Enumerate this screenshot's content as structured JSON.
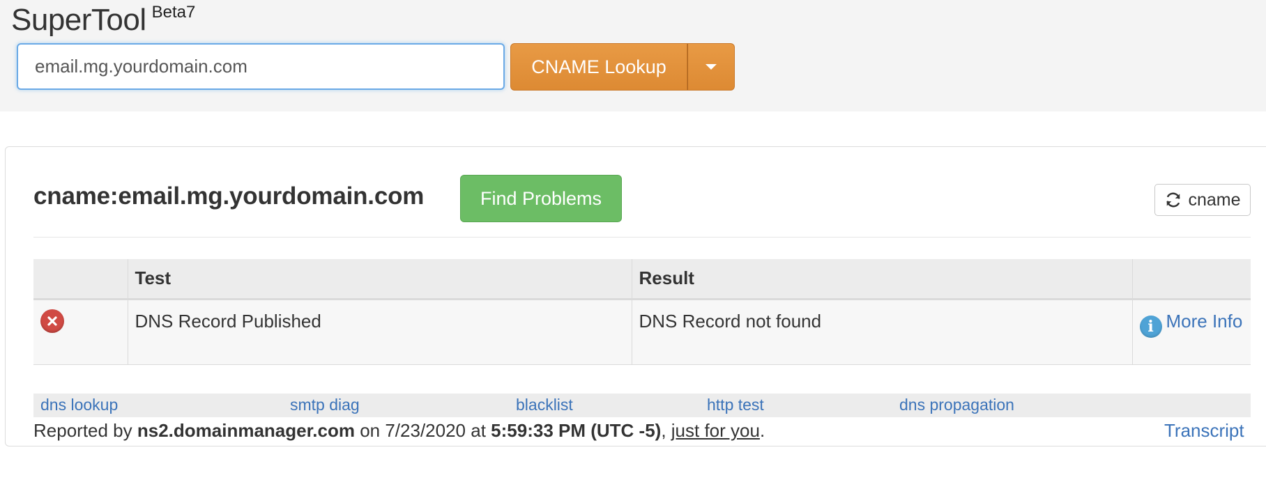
{
  "app": {
    "name": "SuperTool",
    "badge": "Beta7"
  },
  "search": {
    "value": "email.mg.yourdomain.com",
    "button_label": "CNAME Lookup"
  },
  "result_panel": {
    "heading": "cname:email.mg.yourdomain.com",
    "find_problems_label": "Find Problems",
    "refresh_label": "cname",
    "table": {
      "headers": [
        "",
        "Test",
        "Result",
        ""
      ],
      "rows": [
        {
          "status": "error",
          "test": "DNS Record Published",
          "result": "DNS Record not found",
          "more_info_label": "More Info"
        }
      ]
    },
    "quick_links": [
      "dns lookup",
      "smtp diag",
      "blacklist",
      "http test",
      "dns propagation"
    ],
    "footer": {
      "prefix": "Reported by ",
      "server": "ns2.domainmanager.com",
      "on_text": " on 7/23/2020 at ",
      "time": "5:59:33 PM (UTC -5)",
      "comma": ", ",
      "link_text": "just for you",
      "period": ".",
      "transcript_label": "Transcript"
    }
  },
  "colors": {
    "lookup_button": "#e2913b",
    "find_problems_button": "#6cbd65",
    "error_icon": "#d04a44",
    "link": "#3b73b9"
  },
  "icons": [
    "caret-down-icon",
    "refresh-icon",
    "error-icon",
    "info-icon"
  ]
}
